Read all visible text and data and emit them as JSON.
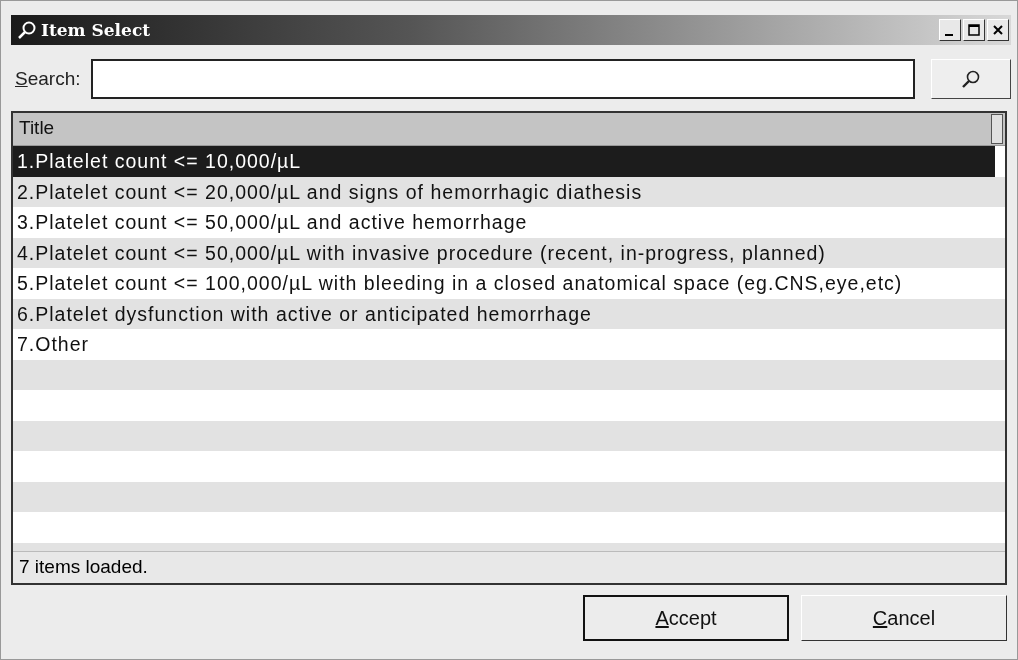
{
  "window": {
    "title": "Item Select"
  },
  "search": {
    "label": "Search:"
  },
  "table": {
    "columns": [
      "Title"
    ],
    "rows": [
      {
        "title": "1.Platelet count <= 10,000/µL",
        "selected": true
      },
      {
        "title": "2.Platelet count <= 20,000/µL and signs of hemorrhagic diathesis",
        "selected": false
      },
      {
        "title": "3.Platelet count <= 50,000/µL and active hemorrhage",
        "selected": false
      },
      {
        "title": "4.Platelet count <= 50,000/µL with invasive procedure (recent, in-progress, planned)",
        "selected": false
      },
      {
        "title": "5.Platelet count <= 100,000/µL with bleeding in a closed anatomical space (eg.CNS,eye,etc)",
        "selected": false
      },
      {
        "title": "6.Platelet dysfunction with active or anticipated hemorrhage",
        "selected": false
      },
      {
        "title": "7.Other",
        "selected": false
      }
    ]
  },
  "status_bar": "7 items loaded.",
  "buttons": [
    "Accept",
    "Cancel"
  ]
}
